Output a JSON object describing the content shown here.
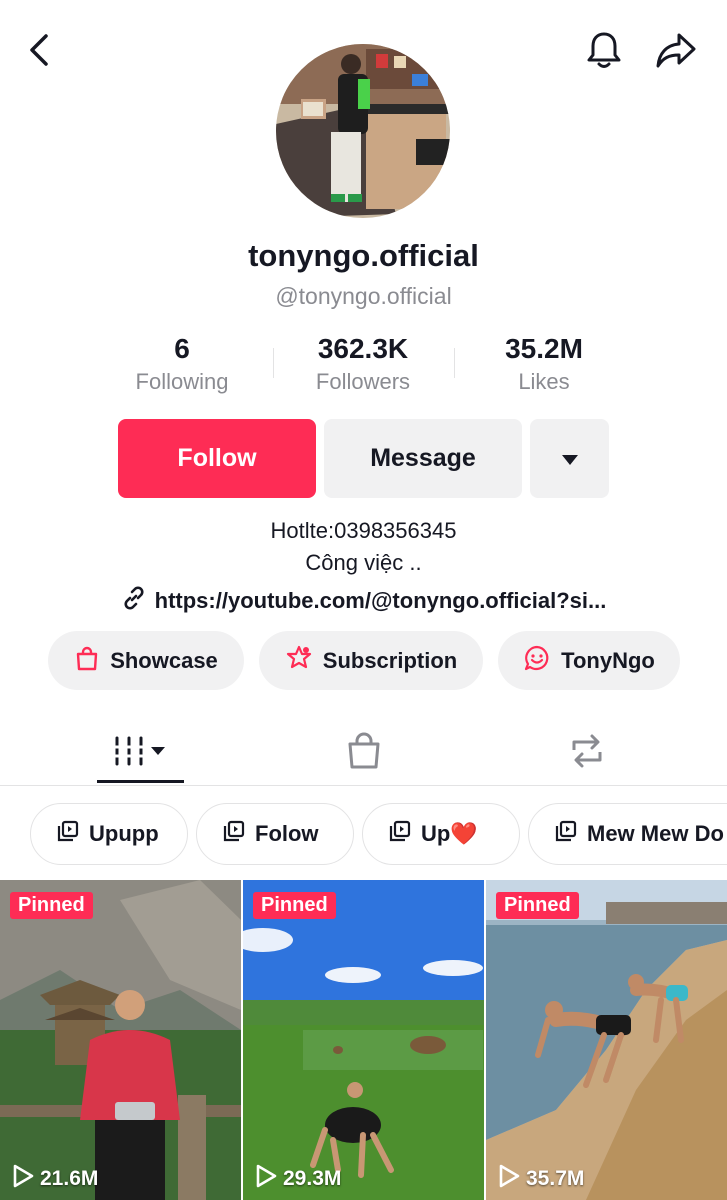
{
  "profile": {
    "display_name": "tonyngo.official",
    "handle": "@tonyngo.official"
  },
  "stats": [
    {
      "value": "6",
      "label": "Following"
    },
    {
      "value": "362.3K",
      "label": "Followers"
    },
    {
      "value": "35.2M",
      "label": "Likes"
    }
  ],
  "actions": {
    "follow_label": "Follow",
    "message_label": "Message"
  },
  "bio": {
    "line1": "Hotlte:0398356345",
    "line2": "Công việc ..",
    "link": "https://youtube.com/@tonyngo.official?si..."
  },
  "pills": [
    {
      "label": "Showcase",
      "icon": "shopping-bag-icon"
    },
    {
      "label": "Subscription",
      "icon": "star-badge-icon"
    },
    {
      "label": "TonyNgo",
      "icon": "chat-smile-icon"
    }
  ],
  "tabs": [
    {
      "icon": "videos-grid-icon",
      "selected": true
    },
    {
      "icon": "shopping-bag-icon",
      "selected": false
    },
    {
      "icon": "repost-icon",
      "selected": false
    }
  ],
  "playlists": [
    {
      "label": "Upupp"
    },
    {
      "label": "Folow"
    },
    {
      "label": "Up❤️"
    },
    {
      "label": "Mew Mew Do"
    }
  ],
  "videos": [
    {
      "badge": "Pinned",
      "views": "21.6M"
    },
    {
      "badge": "Pinned",
      "views": "29.3M"
    },
    {
      "badge": "Pinned",
      "views": "35.7M"
    }
  ],
  "colors": {
    "accent": "#fe2c55",
    "text": "#161823",
    "muted": "#8a8b91",
    "button_bg": "#f1f1f2"
  }
}
